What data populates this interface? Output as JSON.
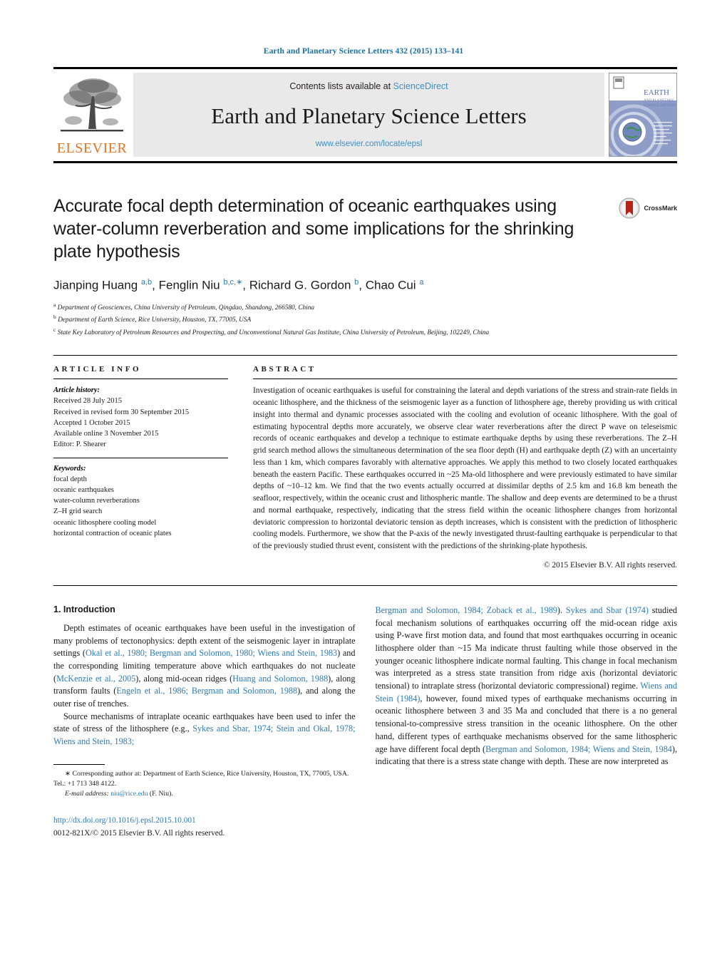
{
  "running_head": "Earth and Planetary Science Letters 432 (2015) 133–141",
  "masthead": {
    "publisher_name": "ELSEVIER",
    "contents_prefix": "Contents lists available at ",
    "contents_link": "ScienceDirect",
    "journal_title": "Earth and Planetary Science Letters",
    "journal_url": "www.elsevier.com/locate/epsl",
    "cover_title_line1": "EARTH",
    "cover_title_line2": "AND PLANETARY",
    "cover_title_line3": "SCIENCE LETTERS"
  },
  "article": {
    "title": "Accurate focal depth determination of oceanic earthquakes using water-column reverberation and some implications for the shrinking plate hypothesis",
    "crossmark_label": "CrossMark",
    "authors_html": "Jianping Huang <sup>a,b</sup>, Fenglin Niu <sup>b,c,</sup><sup class=\"star\">∗</sup>, Richard G. Gordon <sup>b</sup>, Chao Cui <sup>a</sup>",
    "affiliations": [
      {
        "marker": "a",
        "text": "Department of Geosciences, China University of Petroleum, Qingdao, Shandong, 266580, China"
      },
      {
        "marker": "b",
        "text": "Department of Earth Science, Rice University, Houston, TX, 77005, USA"
      },
      {
        "marker": "c",
        "text": "State Key Laboratory of Petroleum Resources and Prospecting, and Unconventional Natural Gas Institute, China University of Petroleum, Beijing, 102249, China"
      }
    ]
  },
  "article_info": {
    "heading": "ARTICLE INFO",
    "history_label": "Article history:",
    "history": [
      "Received 28 July 2015",
      "Received in revised form 30 September 2015",
      "Accepted 1 October 2015",
      "Available online 3 November 2015",
      "Editor: P. Shearer"
    ],
    "keywords_label": "Keywords:",
    "keywords": [
      "focal depth",
      "oceanic earthquakes",
      "water-column reverberations",
      "Z–H grid search",
      "oceanic lithosphere cooling model",
      "horizontal contraction of oceanic plates"
    ]
  },
  "abstract": {
    "heading": "ABSTRACT",
    "text": "Investigation of oceanic earthquakes is useful for constraining the lateral and depth variations of the stress and strain-rate fields in oceanic lithosphere, and the thickness of the seismogenic layer as a function of lithosphere age, thereby providing us with critical insight into thermal and dynamic processes associated with the cooling and evolution of oceanic lithosphere. With the goal of estimating hypocentral depths more accurately, we observe clear water reverberations after the direct P wave on teleseismic records of oceanic earthquakes and develop a technique to estimate earthquake depths by using these reverberations. The Z–H grid search method allows the simultaneous determination of the sea floor depth (H) and earthquake depth (Z) with an uncertainty less than 1 km, which compares favorably with alternative approaches. We apply this method to two closely located earthquakes beneath the eastern Pacific. These earthquakes occurred in ~25 Ma-old lithosphere and were previously estimated to have similar depths of ~10–12 km. We find that the two events actually occurred at dissimilar depths of 2.5 km and 16.8 km beneath the seafloor, respectively, within the oceanic crust and lithospheric mantle. The shallow and deep events are determined to be a thrust and normal earthquake, respectively, indicating that the stress field within the oceanic lithosphere changes from horizontal deviatoric compression to horizontal deviatoric tension as depth increases, which is consistent with the prediction of lithospheric cooling models. Furthermore, we show that the P-axis of the newly investigated thrust-faulting earthquake is perpendicular to that of the previously studied thrust event, consistent with the predictions of the shrinking-plate hypothesis.",
    "copyright": "© 2015 Elsevier B.V. All rights reserved."
  },
  "body": {
    "section_title": "1. Introduction",
    "left_para1_html": "Depth estimates of oceanic earthquakes have been useful in the investigation of many problems of tectonophysics: depth extent of the seismogenic layer in intraplate settings (<span class=\"ref\">Okal et al., 1980; Bergman and Solomon, 1980; Wiens and Stein, 1983</span>) and the corresponding limiting temperature above which earthquakes do not nucleate (<span class=\"ref\">McKenzie et al., 2005</span>), along mid-ocean ridges (<span class=\"ref\">Huang and Solomon, 1988</span>), along transform faults (<span class=\"ref\">Engeln et al., 1986; Bergman and Solomon, 1988</span>), and along the outer rise of trenches.",
    "left_para2_html": "Source mechanisms of intraplate oceanic earthquakes have been used to infer the state of stress of the lithosphere (e.g., <span class=\"ref\">Sykes and Sbar, 1974; Stein and Okal, 1978; Wiens and Stein, 1983;</span>",
    "right_para_html": "<span class=\"ref\">Bergman and Solomon, 1984; Zoback et al., 1989</span>). <span class=\"ref\">Sykes and Sbar (1974)</span> studied focal mechanism solutions of earthquakes occurring off the mid-ocean ridge axis using P-wave first motion data, and found that most earthquakes occurring in oceanic lithosphere older than ~15 Ma indicate thrust faulting while those observed in the younger oceanic lithosphere indicate normal faulting. This change in focal mechanism was interpreted as a stress state transition from ridge axis (horizontal deviatoric tensional) to intraplate stress (horizontal deviatoric compressional) regime. <span class=\"ref\">Wiens and Stein (1984)</span>, however, found mixed types of earthquake mechanisms occurring in oceanic lithosphere between 3 and 35 Ma and concluded that there is a no general tensional-to-compressive stress transition in the oceanic lithosphere. On the other hand, different types of earthquake mechanisms observed for the same lithospheric age have different focal depth (<span class=\"ref\">Bergman and Solomon, 1984; Wiens and Stein, 1984</span>), indicating that there is a stress state change with depth. These are now interpreted as"
  },
  "footnote": {
    "star": "∗",
    "corresponding_html": "Corresponding author at: Department of Earth Science, Rice University, Houston, TX, 77005, USA. Tel.: +1 713 348 4122.",
    "email_label": "E-mail address:",
    "email": "niu@rice.edu",
    "email_suffix": " (F. Niu)."
  },
  "footer": {
    "doi": "http://dx.doi.org/10.1016/j.epsl.2015.10.001",
    "issn_line": "0012-821X/© 2015 Elsevier B.V. All rights reserved."
  },
  "colors": {
    "link_blue": "#2b7bb9",
    "banner_gray": "#e9e9e9",
    "elsevier_orange": "#E9711C",
    "crossmark_red": "#b32317"
  }
}
